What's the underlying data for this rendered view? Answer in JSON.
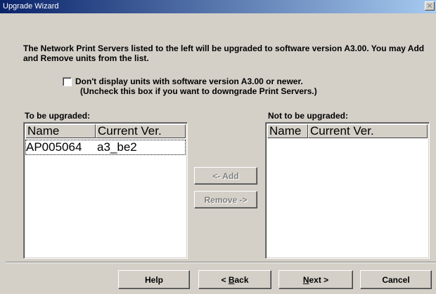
{
  "window": {
    "title": "Upgrade Wizard",
    "close_glyph": "✕"
  },
  "intro_text": "The  Network Print Servers listed to the left will be upgraded to software version A3.00. You may Add and Remove units from the list.",
  "checkbox": {
    "label_line1": "Don't display units with software version A3.00 or newer.",
    "label_line2": "(Uncheck this box if you want to downgrade Print Servers.)",
    "checked": false
  },
  "left_list": {
    "label": "To be upgraded:",
    "columns": [
      "Name",
      "Current Ver."
    ],
    "rows": [
      {
        "name": "AP005064",
        "version": "a3_be2"
      }
    ]
  },
  "right_list": {
    "label": "Not to be upgraded:",
    "columns": [
      "Name",
      "Current Ver."
    ],
    "rows": []
  },
  "transfer_buttons": {
    "add": "<- Add",
    "remove": "Remove ->"
  },
  "footer_buttons": {
    "help": "Help",
    "back_arrow": "< ",
    "back_mnemonic": "B",
    "back_rest": "ack",
    "next_mnemonic": "N",
    "next_rest": "ext >",
    "cancel": "Cancel"
  }
}
